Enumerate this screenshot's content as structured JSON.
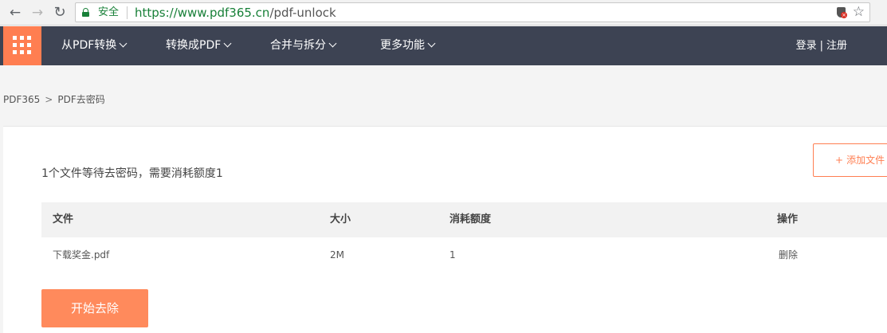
{
  "browser": {
    "secure_label": "安全",
    "url_host": "https://www.pdf365.cn",
    "url_path": "/pdf-unlock"
  },
  "header": {
    "menu_icon": "grid-icon",
    "nav": [
      {
        "label": "从PDF转换"
      },
      {
        "label": "转换成PDF"
      },
      {
        "label": "合并与拆分"
      },
      {
        "label": "更多功能"
      }
    ],
    "login_label": "登录",
    "auth_separator": "|",
    "register_label": "注册",
    "accent_color": "#ff7e51",
    "bg_color": "#3d4353"
  },
  "breadcrumb": {
    "home": "PDF365",
    "separator": ">",
    "current": "PDF去密码"
  },
  "main": {
    "pending_text": "1个文件等待去密码，需要消耗额度1",
    "add_file_label": "添加文件",
    "add_file_icon": "plus-icon",
    "table": {
      "headers": [
        "文件",
        "大小",
        "消耗额度",
        "操作"
      ],
      "rows": [
        {
          "file": "下载奖金.pdf",
          "size": "2M",
          "quota": "1",
          "action": "删除"
        }
      ]
    },
    "start_label": "开始去除"
  }
}
